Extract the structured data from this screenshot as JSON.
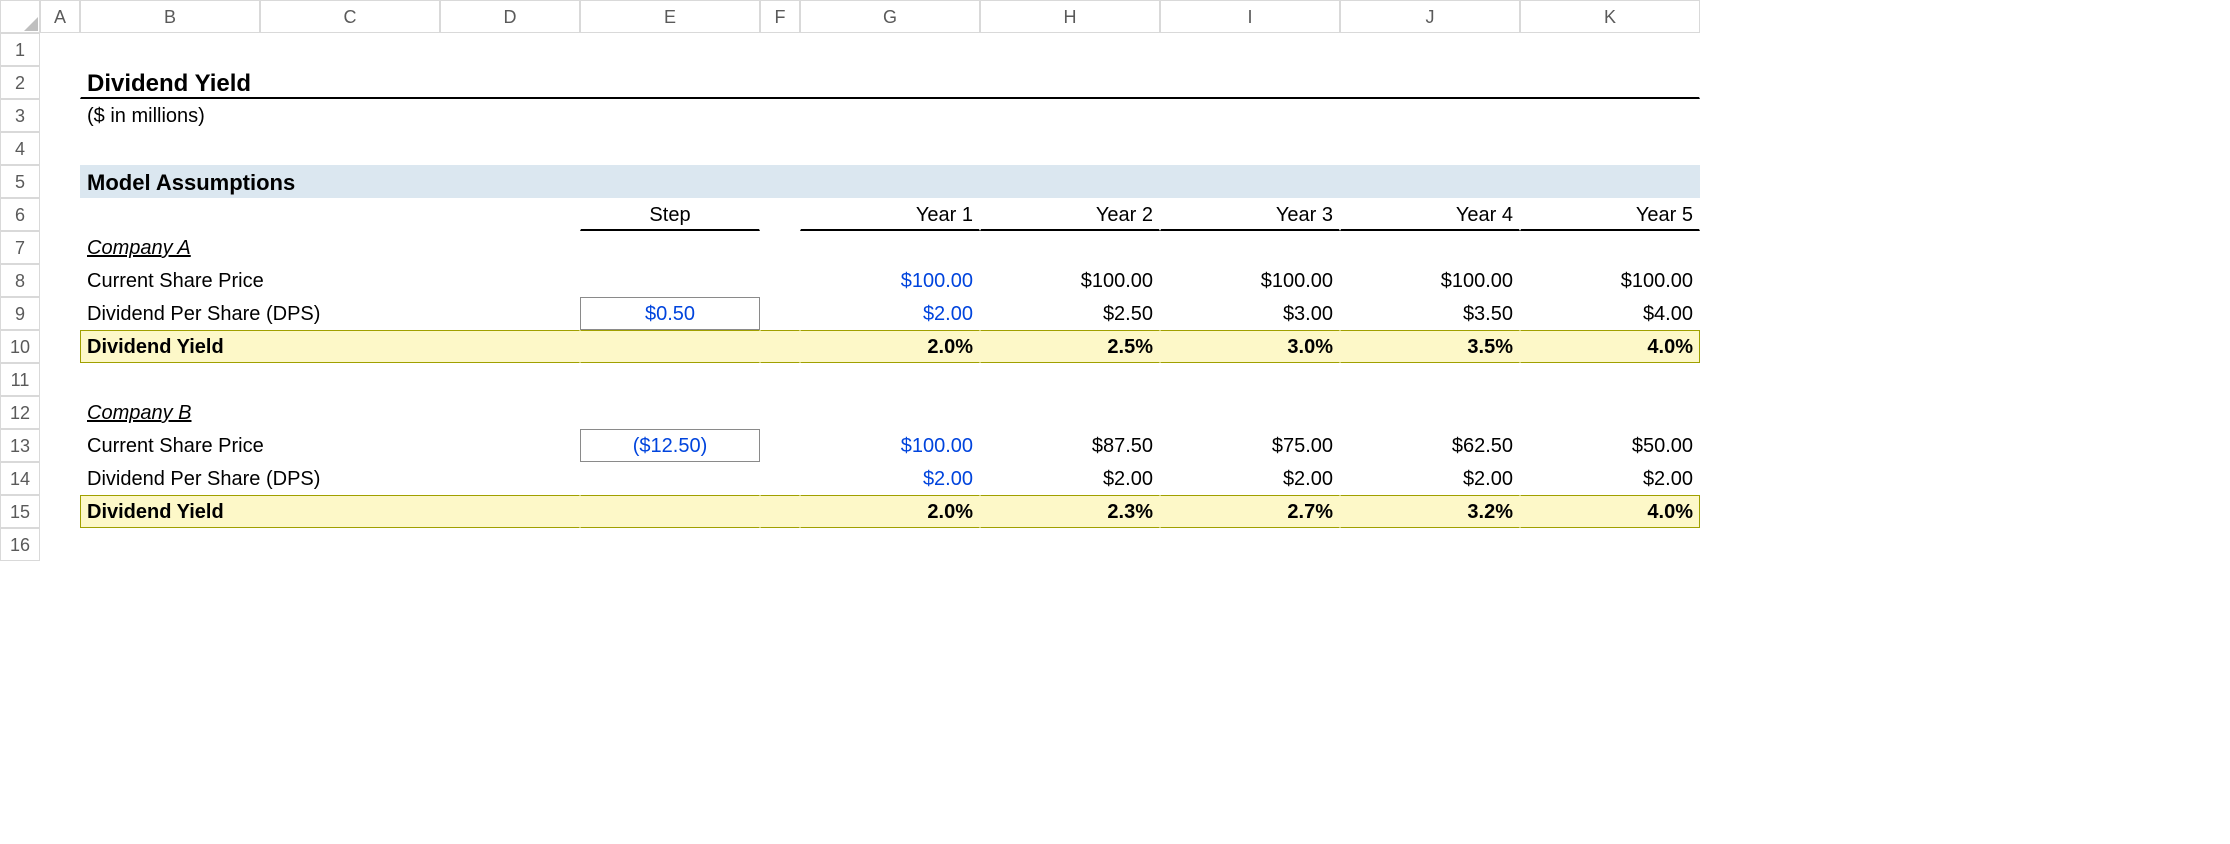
{
  "columns": [
    "A",
    "B",
    "C",
    "D",
    "E",
    "F",
    "G",
    "H",
    "I",
    "J",
    "K"
  ],
  "rows": [
    "1",
    "2",
    "3",
    "4",
    "5",
    "6",
    "7",
    "8",
    "9",
    "10",
    "11",
    "12",
    "13",
    "14",
    "15",
    "16"
  ],
  "title": "Dividend Yield",
  "subtitle": "($ in millions)",
  "section": "Model Assumptions",
  "head": {
    "step": "Step",
    "y1": "Year 1",
    "y2": "Year 2",
    "y3": "Year 3",
    "y4": "Year 4",
    "y5": "Year 5"
  },
  "companyA": {
    "label": "Company A",
    "priceLabel": "Current Share Price",
    "price": [
      "$100.00",
      "$100.00",
      "$100.00",
      "$100.00",
      "$100.00"
    ],
    "dpsLabel": "Dividend Per Share (DPS)",
    "dpsStep": "$0.50",
    "dps": [
      "$2.00",
      "$2.50",
      "$3.00",
      "$3.50",
      "$4.00"
    ],
    "yieldLabel": "Dividend Yield",
    "yield": [
      "2.0%",
      "2.5%",
      "3.0%",
      "3.5%",
      "4.0%"
    ]
  },
  "companyB": {
    "label": "Company B",
    "priceLabel": "Current Share Price",
    "priceStep": "($12.50)",
    "price": [
      "$100.00",
      "$87.50",
      "$75.00",
      "$62.50",
      "$50.00"
    ],
    "dpsLabel": "Dividend Per Share (DPS)",
    "dps": [
      "$2.00",
      "$2.00",
      "$2.00",
      "$2.00",
      "$2.00"
    ],
    "yieldLabel": "Dividend Yield",
    "yield": [
      "2.0%",
      "2.3%",
      "2.7%",
      "3.2%",
      "4.0%"
    ]
  }
}
